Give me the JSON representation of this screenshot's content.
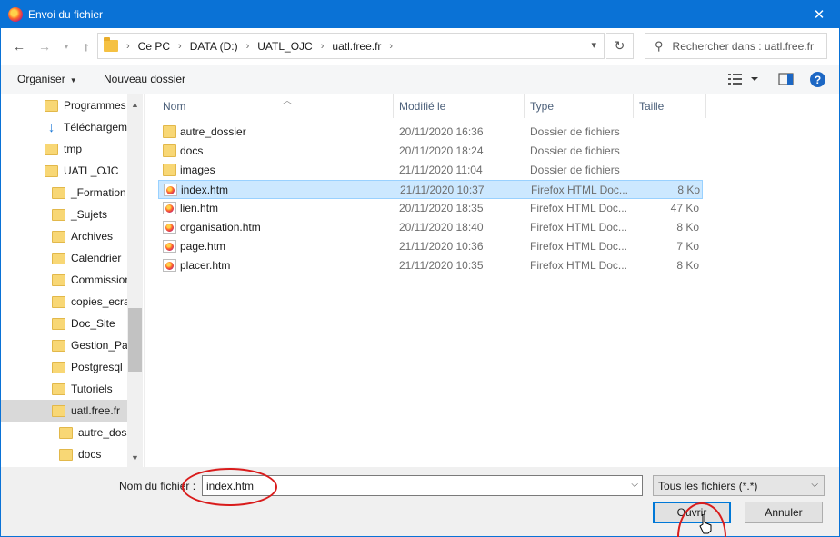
{
  "window": {
    "title": "Envoi du fichier"
  },
  "address": {
    "breadcrumb": [
      "Ce PC",
      "DATA (D:)",
      "UATL_OJC",
      "uatl.free.fr"
    ],
    "search_placeholder": "Rechercher dans : uatl.free.fr"
  },
  "toolbar": {
    "organize_label": "Organiser",
    "new_folder_label": "Nouveau dossier"
  },
  "navpane": {
    "items": [
      {
        "label": "Programmes",
        "indent": 1,
        "icon": "folder-icon"
      },
      {
        "label": "Téléchargeme",
        "indent": 1,
        "icon": "download-icon"
      },
      {
        "label": "tmp",
        "indent": 1,
        "icon": "folder-icon"
      },
      {
        "label": "UATL_OJC",
        "indent": 1,
        "icon": "folder-icon"
      },
      {
        "label": "_Formation",
        "indent": 2,
        "icon": "folder-icon"
      },
      {
        "label": "_Sujets",
        "indent": 2,
        "icon": "folder-icon"
      },
      {
        "label": "Archives",
        "indent": 2,
        "icon": "folder-icon"
      },
      {
        "label": "Calendrier",
        "indent": 2,
        "icon": "folder-icon"
      },
      {
        "label": "Commission",
        "indent": 2,
        "icon": "folder-icon"
      },
      {
        "label": "copies_ecra",
        "indent": 2,
        "icon": "folder-icon"
      },
      {
        "label": "Doc_Site",
        "indent": 2,
        "icon": "folder-icon"
      },
      {
        "label": "Gestion_Pag",
        "indent": 2,
        "icon": "folder-icon"
      },
      {
        "label": "Postgresql",
        "indent": 2,
        "icon": "folder-icon"
      },
      {
        "label": "Tutoriels",
        "indent": 2,
        "icon": "folder-icon"
      },
      {
        "label": "uatl.free.fr",
        "indent": 2,
        "icon": "folder-icon",
        "selected": true
      },
      {
        "label": "autre_doss",
        "indent": 3,
        "icon": "folder-icon"
      },
      {
        "label": "docs",
        "indent": 3,
        "icon": "folder-icon"
      }
    ]
  },
  "filelist": {
    "columns": {
      "name": "Nom",
      "modified": "Modifié le",
      "type": "Type",
      "size": "Taille"
    },
    "rows": [
      {
        "name": "autre_dossier",
        "modified": "20/11/2020 16:36",
        "type": "Dossier de fichiers",
        "size": "",
        "kind": "folder"
      },
      {
        "name": "docs",
        "modified": "20/11/2020 18:24",
        "type": "Dossier de fichiers",
        "size": "",
        "kind": "folder"
      },
      {
        "name": "images",
        "modified": "21/11/2020 11:04",
        "type": "Dossier de fichiers",
        "size": "",
        "kind": "folder"
      },
      {
        "name": "index.htm",
        "modified": "21/11/2020 10:37",
        "type": "Firefox HTML Doc...",
        "size": "8 Ko",
        "kind": "html",
        "selected": true
      },
      {
        "name": "lien.htm",
        "modified": "20/11/2020 18:35",
        "type": "Firefox HTML Doc...",
        "size": "47 Ko",
        "kind": "html"
      },
      {
        "name": "organisation.htm",
        "modified": "20/11/2020 18:40",
        "type": "Firefox HTML Doc...",
        "size": "8 Ko",
        "kind": "html"
      },
      {
        "name": "page.htm",
        "modified": "21/11/2020 10:36",
        "type": "Firefox HTML Doc...",
        "size": "7 Ko",
        "kind": "html"
      },
      {
        "name": "placer.htm",
        "modified": "21/11/2020 10:35",
        "type": "Firefox HTML Doc...",
        "size": "8 Ko",
        "kind": "html"
      }
    ]
  },
  "footer": {
    "filename_label": "Nom du fichier :",
    "filename_value": "index.htm",
    "filter_value": "Tous les fichiers (*.*)",
    "open_label": "Ouvrir",
    "cancel_label": "Annuler"
  },
  "colors": {
    "titlebar": "#0a72d6",
    "selection": "#cce8ff",
    "annotation": "#d91c1c"
  }
}
